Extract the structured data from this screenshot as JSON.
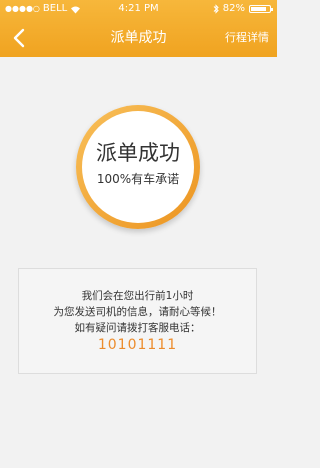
{
  "status_bar": {
    "carrier": "BELL",
    "time": "4:21 PM",
    "battery_percent": "82%",
    "battery_level": 0.82
  },
  "nav": {
    "title": "派单成功",
    "right_action": "行程详情"
  },
  "badge": {
    "title": "派单成功",
    "subtitle": "100%有车承诺"
  },
  "info": {
    "line1": "我们会在您出行前1小时",
    "line2": "为您发送司机的信息，请耐心等候！",
    "line3": "如有疑问请拨打客服电话：",
    "phone": "10101111"
  },
  "colors": {
    "accent": "#f0a320",
    "phone": "#ec8c2c"
  },
  "icons": [
    "signal-icon",
    "wifi-icon",
    "bluetooth-icon",
    "battery-icon",
    "back-arrow-icon"
  ]
}
